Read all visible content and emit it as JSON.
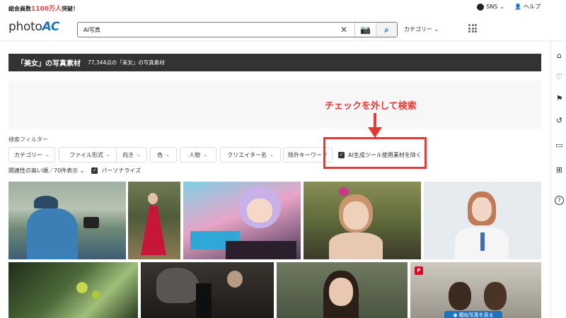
{
  "top": {
    "member_prefix": "総会員数",
    "member_count": "1100万人",
    "member_suffix": "突破！",
    "sns_label": "SNS",
    "help_label": "ヘルプ"
  },
  "header": {
    "logo_photo": "photo",
    "logo_ac": "AC",
    "search_value": "AI写真",
    "clear_glyph": "✕",
    "camera_glyph": "📷",
    "search_glyph": "⌕",
    "category_label": "カテゴリー ⌄"
  },
  "title": {
    "main": "「美女」の写真素材",
    "sub": "77,344点の「美女」の写真素材"
  },
  "annotation": {
    "text": "チェックを外して検索"
  },
  "filters": {
    "label": "検索フィルター",
    "chips": [
      "カテゴリー",
      "ファイル形式",
      "向き",
      "色",
      "人物",
      "クリエイター名"
    ],
    "exclude_keyword": "除外キーワード",
    "ai_exclude_label": "AI生成ツール使用素材を除く",
    "check_glyph": "✓",
    "chevron": "⌄"
  },
  "sort": {
    "label": "関連性の高い順／70件表示 ⌄",
    "personalize_label": "パーソナライズ"
  },
  "rail": {
    "icons": [
      "home-icon",
      "heart-icon",
      "bookmark-icon",
      "history-icon",
      "folder-icon",
      "folder-add-icon",
      "help-icon"
    ],
    "glyphs": [
      "⌂",
      "♡",
      "⚑",
      "↺",
      "▭",
      "⊞",
      "?"
    ]
  },
  "photos": {
    "pin_glyph": "P",
    "similar_label": "類似写真を見る"
  },
  "colors": {
    "accent": "#1e73be",
    "highlight": "#e53935",
    "titlebar": "#333333"
  }
}
